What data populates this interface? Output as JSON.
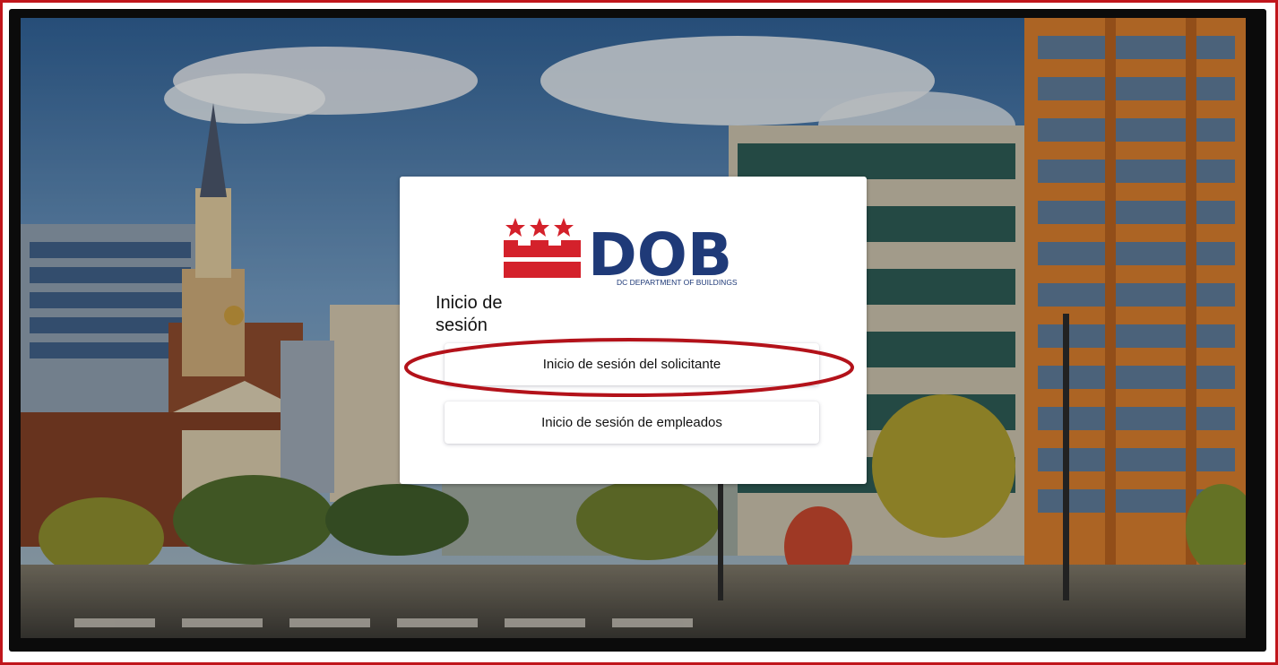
{
  "brand": {
    "logo_letters": "DOB",
    "logo_subtitle": "DC DEPARTMENT OF BUILDINGS",
    "primary_color": "#1f3a78",
    "accent_color": "#d4212b"
  },
  "login": {
    "title": "Inicio de sesión",
    "applicant_button": "Inicio de sesión del solicitante",
    "employee_button": "Inicio de sesión de empleados"
  },
  "annotation": {
    "highlight_color": "#b3121a",
    "highlight_target": "applicant_button"
  },
  "background": {
    "description_icon": "city-street-photo"
  }
}
